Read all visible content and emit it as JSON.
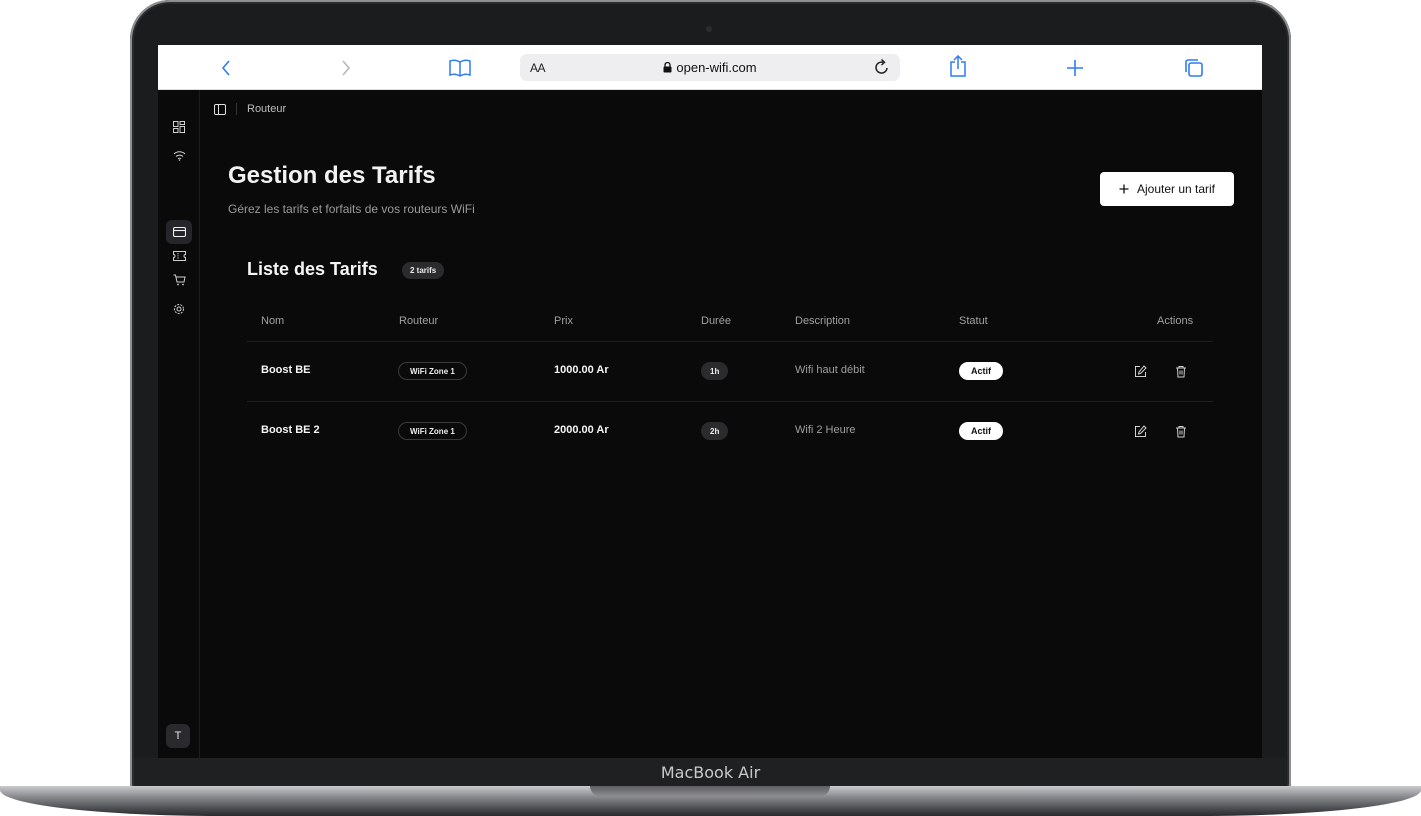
{
  "device": {
    "label": "MacBook Air"
  },
  "browser": {
    "text_size_label": "AA",
    "url": "open-wifi.com",
    "icons": [
      "back-icon",
      "forward-icon",
      "bookmarks-icon",
      "lock-icon",
      "reload-icon",
      "share-icon",
      "new-tab-icon",
      "tabs-icon"
    ]
  },
  "sidebar": {
    "items": [
      {
        "icon": "dashboard-icon"
      },
      {
        "icon": "wifi-icon"
      },
      {
        "icon": "card-icon",
        "active": true
      },
      {
        "icon": "ticket-icon"
      },
      {
        "icon": "cart-icon"
      },
      {
        "icon": "settings-icon"
      }
    ],
    "avatar": "T"
  },
  "breadcrumb": {
    "label": "Routeur"
  },
  "header": {
    "title": "Gestion des Tarifs",
    "subtitle": "Gérez les tarifs et forfaits de vos routeurs WiFi",
    "add_button": "Ajouter un tarif"
  },
  "list": {
    "title": "Liste des Tarifs",
    "count": "2 tarifs",
    "columns": [
      "Nom",
      "Routeur",
      "Prix",
      "Durée",
      "Description",
      "Statut",
      "Actions"
    ],
    "rows": [
      {
        "name": "Boost BE",
        "router": "WiFi Zone 1",
        "price": "1000.00 Ar",
        "duration": "1h",
        "description": "Wifi haut débit",
        "status": "Actif"
      },
      {
        "name": "Boost BE 2",
        "router": "WiFi Zone 1",
        "price": "2000.00 Ar",
        "duration": "2h",
        "description": "Wifi 2 Heure",
        "status": "Actif"
      }
    ]
  },
  "colors": {
    "screen_bg": "#0a0a0b",
    "browser_accent": "#2f7cf6",
    "text": "#f2f2f2"
  }
}
